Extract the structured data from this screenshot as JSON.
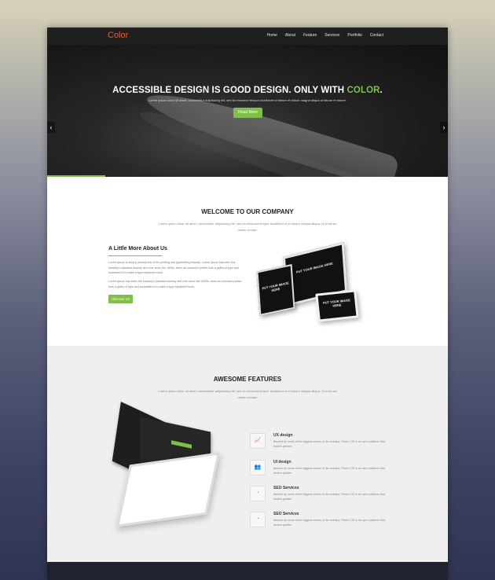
{
  "nav": {
    "logo": "Color",
    "links": [
      "Home",
      "About",
      "Feature",
      "Services",
      "Portfolio",
      "Contact"
    ]
  },
  "hero": {
    "title_main": "ACCESSIBLE DESIGN IS GOOD DESIGN. ONLY WITH ",
    "title_accent": "COLOR",
    "title_end": ".",
    "subtitle": "Lorem ipsum dolor sit amet, consectetur adipisicing elit, sed do eiusmod tempor incididunt ut labore et dolore magna aliqua ut labore et dolore.",
    "button": "Read More",
    "arrow_left": "‹",
    "arrow_right": "›",
    "slide_progress": 0.145
  },
  "welcome": {
    "title": "WELCOME TO OUR COMPANY",
    "subtitle": "Lorem ipsum dolor sit amet, consectetur adipisicing elit, sed do eiusmod tempor incididunt ut et dolore magna aliqua. Ut enim ad minim veniam",
    "about_title": "A Little More About Us",
    "paragraph1": "Lorem Ipsum is simply dummy text of the printing and typesetting industry. Lorem Ipsum has been the industry's standard dummy text ever since the 1500s, when an unknown printer took a galley of type and scrambled it to make a type specimen book.",
    "paragraph2": "Lorem Ipsum has been the industry's standard dummy text ever since the 1500s, when an unknown printer took a galley of type and scrambled it to make a type specimen book.",
    "button": "Discover Us",
    "device_monitor_text": "PUT YOUR IMAGE HERE",
    "device_tablet_text": "PUT YOUR IMAGE HERE",
    "device_phone_text": "PUT YOUR IMAGE HERE"
  },
  "features": {
    "title": "AWESOME FEATURES",
    "subtitle": "Lorem ipsum dolor sit amet, consectetur adipisicing elit, sed do eiusmod tempor incididunt ut et dolore magna aliqua. Ut enim ad minim veniam",
    "items": [
      {
        "icon": "chart-icon",
        "glyph": "📈",
        "title": "UX design",
        "desc": "Backed by some of the biggest names in the industry, Firefox OS is an open platform that fosters greater"
      },
      {
        "icon": "users-icon",
        "glyph": "👥",
        "title": "UI design",
        "desc": "Backed by some of the biggest names in the industry, Firefox OS is an open platform that fosters greater"
      },
      {
        "icon": "pie-icon",
        "glyph": "◔",
        "title": "SEO Services",
        "desc": "Backed by some of the biggest names in the industry, Firefox OS is an open platform that fosters greater"
      },
      {
        "icon": "pie-icon",
        "glyph": "◔",
        "title": "SEO Services",
        "desc": "Backed by some of the biggest names in the industry, Firefox OS is an open platform that fosters greater"
      }
    ]
  },
  "colors": {
    "accent": "#7cc242",
    "logo": "#e0603a",
    "nav_bg": "#1f1f1f",
    "footer_bg": "#1f2230"
  }
}
